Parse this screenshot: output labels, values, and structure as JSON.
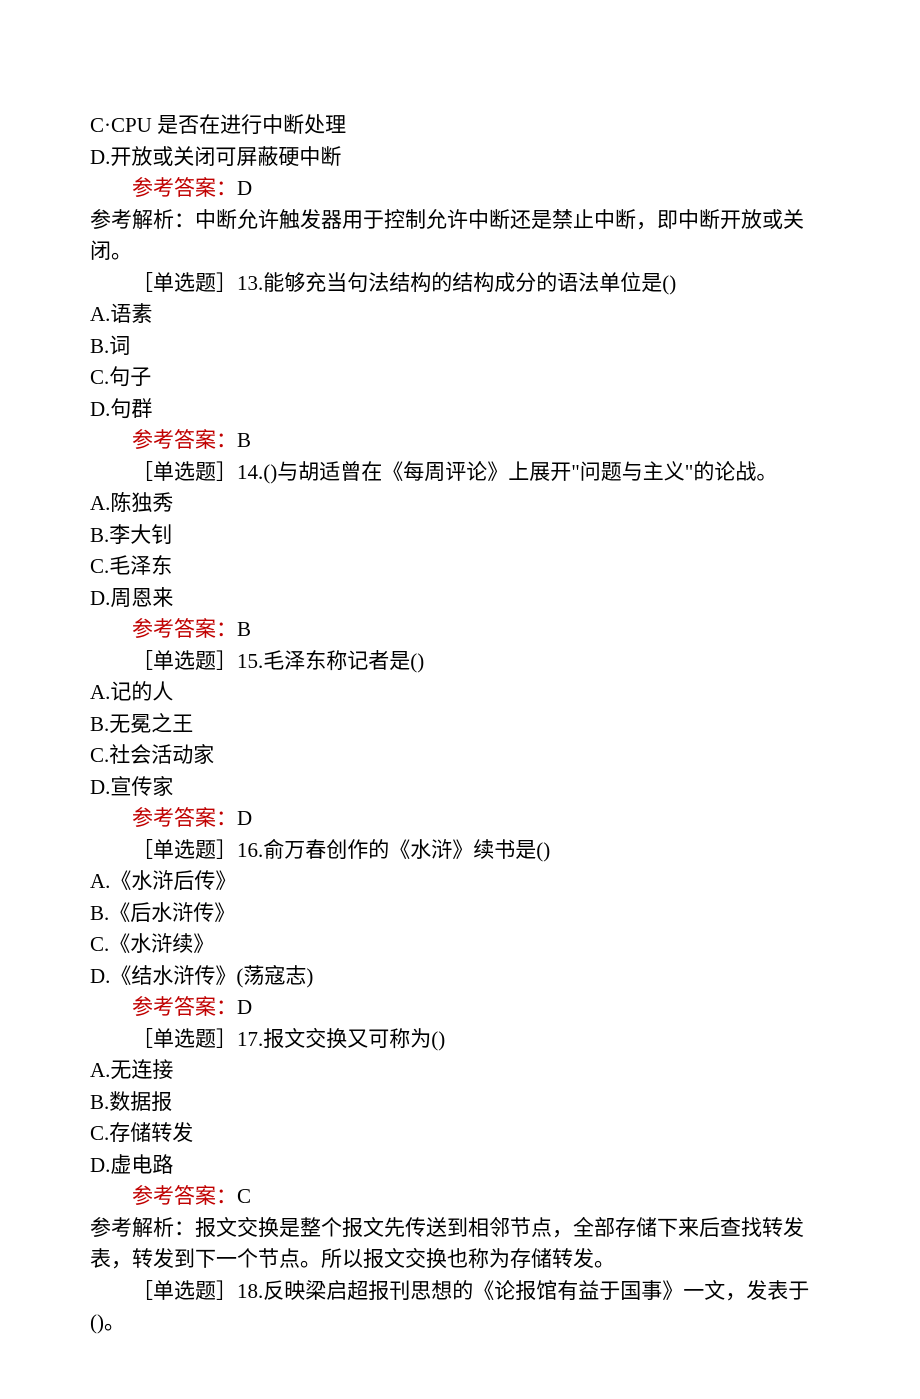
{
  "strings": {
    "answer_label": "参考答案："
  },
  "q12_tail": {
    "optC": "C·CPU 是否在进行中断处理",
    "optD": "D.开放或关闭可屏蔽硬中断",
    "answer": "D",
    "explain": "参考解析：中断允许触发器用于控制允许中断还是禁止中断，即中断开放或关闭。"
  },
  "q13": {
    "stem": "［单选题］13.能够充当句法结构的结构成分的语法单位是()",
    "optA": "A.语素",
    "optB": "B.词",
    "optC": "C.句子",
    "optD": "D.句群",
    "answer": "B"
  },
  "q14": {
    "stem": "［单选题］14.()与胡适曾在《每周评论》上展开\"问题与主义\"的论战。",
    "optA": "A.陈独秀",
    "optB": "B.李大钊",
    "optC": "C.毛泽东",
    "optD": "D.周恩来",
    "answer": "B"
  },
  "q15": {
    "stem": "［单选题］15.毛泽东称记者是()",
    "optA": "A.记的人",
    "optB": "B.无冕之王",
    "optC": "C.社会活动家",
    "optD": "D.宣传家",
    "answer": "D"
  },
  "q16": {
    "stem": "［单选题］16.俞万春创作的《水浒》续书是()",
    "optA": "A.《水浒后传》",
    "optB": "B.《后水浒传》",
    "optC": "C.《水浒续》",
    "optD": "D.《结水浒传》(荡寇志)",
    "answer": "D"
  },
  "q17": {
    "stem": "［单选题］17.报文交换又可称为()",
    "optA": "A.无连接",
    "optB": "B.数据报",
    "optC": "C.存储转发",
    "optD": "D.虚电路",
    "answer": "C",
    "explain": "参考解析：报文交换是整个报文先传送到相邻节点，全部存储下来后查找转发表，转发到下一个节点。所以报文交换也称为存储转发。"
  },
  "q18": {
    "stem": "［单选题］18.反映梁启超报刊思想的《论报馆有益于国事》一文，发表于()。"
  }
}
